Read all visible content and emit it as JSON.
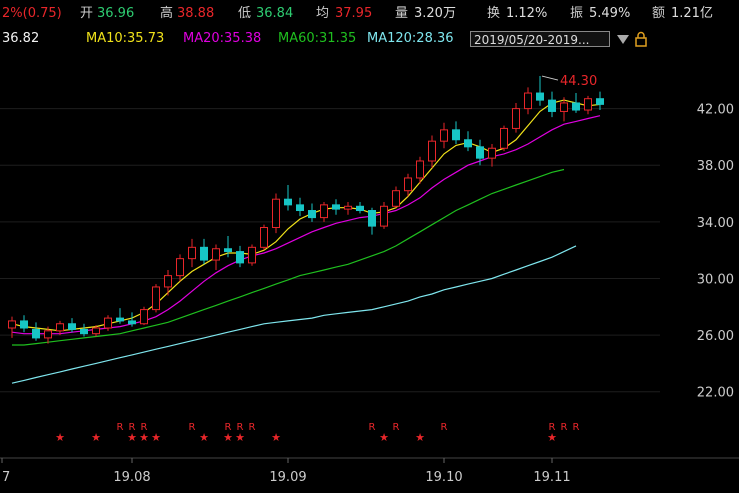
{
  "quote": {
    "change": "2%(0.75)",
    "open_label": "开",
    "open_value": "36.96",
    "high_label": "高",
    "high_value": "38.88",
    "low_label": "低",
    "low_value": "36.84",
    "avg_label": "均",
    "avg_value": "37.95",
    "volume_label": "量",
    "volume_value": "3.20万",
    "turnover_label": "换",
    "turnover_value": "1.12%",
    "amplitude_label": "振",
    "amplitude_value": "5.49%",
    "amount_label": "额",
    "amount_value": "1.21亿"
  },
  "indicators": {
    "ma5": "36.82",
    "ma10": "MA10:35.73",
    "ma20": "MA20:35.38",
    "ma60": "MA60:31.35",
    "ma120": "MA120:28.36",
    "range": "2019/05/20-2019...",
    "dropdown_icon": "triangle-down-icon",
    "lock_icon": "lock-icon"
  },
  "colors": {
    "background": "#000000",
    "up": "#e8262a",
    "down": "#17c6c6",
    "ma5": "#f2f2f2",
    "ma10": "#f0e21a",
    "ma20": "#e000e0",
    "ma60": "#1fbf1f",
    "ma120": "#7fe6ee",
    "quote_up": "#e8262a",
    "quote_down": "#2ecc71",
    "label": "#dddddd"
  },
  "chart_data": {
    "type": "candlestick",
    "ylim": [
      20,
      46
    ],
    "y_ticks": [
      "22.00",
      "26.00",
      "30.00",
      "34.00",
      "38.00",
      "42.00"
    ],
    "x_ticks": [
      "7",
      "19.08",
      "19.09",
      "19.10",
      "19.11"
    ],
    "max_annotation": "44.30",
    "ma_series": [
      {
        "name": "MA10",
        "color": "#f0e21a",
        "values": [
          26.8,
          26.6,
          26.5,
          26.4,
          26.3,
          26.4,
          26.5,
          26.6,
          26.8,
          27.0,
          27.2,
          27.6,
          28.2,
          29.0,
          29.8,
          30.5,
          31.0,
          31.5,
          31.8,
          31.8,
          31.7,
          32.0,
          32.6,
          33.5,
          34.2,
          34.6,
          34.9,
          35.0,
          35.0,
          34.9,
          34.6,
          34.7,
          35.0,
          35.8,
          36.8,
          37.8,
          38.8,
          39.4,
          39.6,
          39.3,
          38.9,
          39.2,
          39.8,
          40.8,
          41.8,
          42.4,
          42.6,
          42.4,
          42.2,
          42.3
        ]
      },
      {
        "name": "MA20",
        "color": "#e000e0",
        "values": [
          26.2,
          26.1,
          26.1,
          26.1,
          26.1,
          26.2,
          26.3,
          26.4,
          26.5,
          26.6,
          26.8,
          27.0,
          27.3,
          27.8,
          28.4,
          29.1,
          29.8,
          30.4,
          30.9,
          31.3,
          31.6,
          31.8,
          32.1,
          32.5,
          32.9,
          33.3,
          33.6,
          33.9,
          34.1,
          34.3,
          34.4,
          34.6,
          34.8,
          35.2,
          35.7,
          36.4,
          37.0,
          37.5,
          38.0,
          38.3,
          38.6,
          38.8,
          39.1,
          39.5,
          40.0,
          40.5,
          40.9,
          41.1,
          41.3,
          41.5
        ]
      },
      {
        "name": "MA60",
        "color": "#1fbf1f",
        "values": [
          25.3,
          25.3,
          25.4,
          25.5,
          25.6,
          25.7,
          25.8,
          25.9,
          26.0,
          26.1,
          26.3,
          26.5,
          26.7,
          26.9,
          27.2,
          27.5,
          27.8,
          28.1,
          28.4,
          28.7,
          29.0,
          29.3,
          29.6,
          29.9,
          30.2,
          30.4,
          30.6,
          30.8,
          31.0,
          31.3,
          31.6,
          31.9,
          32.3,
          32.8,
          33.3,
          33.8,
          34.3,
          34.8,
          35.2,
          35.6,
          36.0,
          36.3,
          36.6,
          36.9,
          37.2,
          37.5,
          37.7
        ]
      },
      {
        "name": "MA120",
        "color": "#7fe6ee",
        "values": [
          22.6,
          22.8,
          23.0,
          23.2,
          23.4,
          23.6,
          23.8,
          24.0,
          24.2,
          24.4,
          24.6,
          24.8,
          25.0,
          25.2,
          25.4,
          25.6,
          25.8,
          26.0,
          26.2,
          26.4,
          26.6,
          26.8,
          26.9,
          27.0,
          27.1,
          27.2,
          27.4,
          27.5,
          27.6,
          27.7,
          27.8,
          28.0,
          28.2,
          28.4,
          28.7,
          28.9,
          29.2,
          29.4,
          29.6,
          29.8,
          30.0,
          30.3,
          30.6,
          30.9,
          31.2,
          31.5,
          31.9,
          32.3
        ]
      }
    ],
    "candles": [
      {
        "o": 26.5,
        "h": 27.3,
        "l": 25.8,
        "c": 27.0
      },
      {
        "o": 27.0,
        "h": 27.4,
        "l": 26.2,
        "c": 26.5
      },
      {
        "o": 26.4,
        "h": 26.9,
        "l": 25.6,
        "c": 25.8
      },
      {
        "o": 25.8,
        "h": 26.6,
        "l": 25.4,
        "c": 26.3
      },
      {
        "o": 26.3,
        "h": 27.0,
        "l": 26.0,
        "c": 26.8
      },
      {
        "o": 26.8,
        "h": 27.2,
        "l": 26.2,
        "c": 26.4
      },
      {
        "o": 26.4,
        "h": 26.8,
        "l": 25.9,
        "c": 26.1
      },
      {
        "o": 26.1,
        "h": 26.7,
        "l": 25.9,
        "c": 26.5
      },
      {
        "o": 26.5,
        "h": 27.4,
        "l": 26.3,
        "c": 27.2
      },
      {
        "o": 27.2,
        "h": 27.9,
        "l": 26.8,
        "c": 27.0
      },
      {
        "o": 27.0,
        "h": 27.6,
        "l": 26.6,
        "c": 26.8
      },
      {
        "o": 26.8,
        "h": 28.0,
        "l": 26.7,
        "c": 27.8
      },
      {
        "o": 27.8,
        "h": 29.6,
        "l": 27.6,
        "c": 29.4
      },
      {
        "o": 29.4,
        "h": 30.6,
        "l": 28.8,
        "c": 30.2
      },
      {
        "o": 30.2,
        "h": 31.7,
        "l": 29.8,
        "c": 31.4
      },
      {
        "o": 31.4,
        "h": 32.8,
        "l": 30.8,
        "c": 32.2
      },
      {
        "o": 32.2,
        "h": 32.8,
        "l": 31.0,
        "c": 31.3
      },
      {
        "o": 31.3,
        "h": 32.4,
        "l": 30.6,
        "c": 32.1
      },
      {
        "o": 32.1,
        "h": 33.0,
        "l": 31.5,
        "c": 31.9
      },
      {
        "o": 31.9,
        "h": 32.3,
        "l": 30.8,
        "c": 31.1
      },
      {
        "o": 31.1,
        "h": 32.4,
        "l": 30.9,
        "c": 32.2
      },
      {
        "o": 32.2,
        "h": 33.8,
        "l": 32.0,
        "c": 33.6
      },
      {
        "o": 33.6,
        "h": 36.0,
        "l": 33.2,
        "c": 35.6
      },
      {
        "o": 35.6,
        "h": 36.6,
        "l": 34.8,
        "c": 35.2
      },
      {
        "o": 35.2,
        "h": 35.7,
        "l": 34.4,
        "c": 34.8
      },
      {
        "o": 34.8,
        "h": 35.3,
        "l": 34.0,
        "c": 34.3
      },
      {
        "o": 34.3,
        "h": 35.4,
        "l": 34.0,
        "c": 35.2
      },
      {
        "o": 35.2,
        "h": 35.6,
        "l": 34.5,
        "c": 34.9
      },
      {
        "o": 34.9,
        "h": 35.4,
        "l": 34.5,
        "c": 35.1
      },
      {
        "o": 35.1,
        "h": 35.4,
        "l": 34.6,
        "c": 34.8
      },
      {
        "o": 34.8,
        "h": 35.0,
        "l": 33.1,
        "c": 33.7
      },
      {
        "o": 33.7,
        "h": 35.4,
        "l": 33.5,
        "c": 35.1
      },
      {
        "o": 35.1,
        "h": 36.5,
        "l": 35.0,
        "c": 36.2
      },
      {
        "o": 36.2,
        "h": 37.4,
        "l": 35.8,
        "c": 37.1
      },
      {
        "o": 37.1,
        "h": 38.6,
        "l": 36.7,
        "c": 38.3
      },
      {
        "o": 38.3,
        "h": 40.1,
        "l": 37.8,
        "c": 39.7
      },
      {
        "o": 39.7,
        "h": 41.0,
        "l": 39.2,
        "c": 40.5
      },
      {
        "o": 40.5,
        "h": 41.1,
        "l": 39.5,
        "c": 39.8
      },
      {
        "o": 39.8,
        "h": 40.4,
        "l": 39.0,
        "c": 39.3
      },
      {
        "o": 39.3,
        "h": 39.8,
        "l": 38.0,
        "c": 38.5
      },
      {
        "o": 38.5,
        "h": 39.5,
        "l": 37.9,
        "c": 39.2
      },
      {
        "o": 39.2,
        "h": 40.8,
        "l": 39.0,
        "c": 40.6
      },
      {
        "o": 40.6,
        "h": 42.4,
        "l": 40.3,
        "c": 42.0
      },
      {
        "o": 42.0,
        "h": 43.5,
        "l": 41.6,
        "c": 43.1
      },
      {
        "o": 43.1,
        "h": 44.3,
        "l": 42.2,
        "c": 42.6
      },
      {
        "o": 42.6,
        "h": 43.2,
        "l": 41.4,
        "c": 41.8
      },
      {
        "o": 41.8,
        "h": 42.8,
        "l": 41.1,
        "c": 42.4
      },
      {
        "o": 42.4,
        "h": 43.1,
        "l": 41.7,
        "c": 41.9
      },
      {
        "o": 41.9,
        "h": 42.9,
        "l": 41.6,
        "c": 42.7
      },
      {
        "o": 42.7,
        "h": 43.2,
        "l": 41.9,
        "c": 42.3
      }
    ],
    "signals": [
      {
        "i": 4,
        "mark": "★"
      },
      {
        "i": 7,
        "mark": "★"
      },
      {
        "i": 9,
        "mark": "R"
      },
      {
        "i": 10,
        "mark": "R"
      },
      {
        "i": 11,
        "mark": "R"
      },
      {
        "i": 10,
        "mark": "★"
      },
      {
        "i": 11,
        "mark": "★"
      },
      {
        "i": 12,
        "mark": "★"
      },
      {
        "i": 15,
        "mark": "R"
      },
      {
        "i": 16,
        "mark": "★"
      },
      {
        "i": 18,
        "mark": "R"
      },
      {
        "i": 19,
        "mark": "R"
      },
      {
        "i": 20,
        "mark": "R"
      },
      {
        "i": 18,
        "mark": "★"
      },
      {
        "i": 19,
        "mark": "★"
      },
      {
        "i": 22,
        "mark": "★"
      },
      {
        "i": 30,
        "mark": "R"
      },
      {
        "i": 32,
        "mark": "R"
      },
      {
        "i": 31,
        "mark": "★"
      },
      {
        "i": 34,
        "mark": "★"
      },
      {
        "i": 36,
        "mark": "R"
      },
      {
        "i": 45,
        "mark": "R"
      },
      {
        "i": 46,
        "mark": "R"
      },
      {
        "i": 47,
        "mark": "R"
      },
      {
        "i": 45,
        "mark": "★"
      }
    ]
  }
}
